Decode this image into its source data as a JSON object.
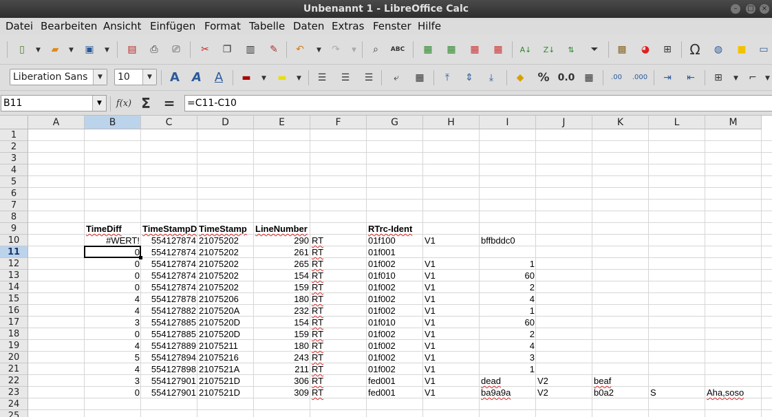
{
  "window": {
    "title": "Unbenannt 1 - LibreOffice Calc"
  },
  "menu": [
    "Datei",
    "Bearbeiten",
    "Ansicht",
    "Einfügen",
    "Format",
    "Tabelle",
    "Daten",
    "Extras",
    "Fenster",
    "Hilfe"
  ],
  "format_toolbar": {
    "font_name": "Liberation Sans",
    "font_size": "10"
  },
  "formula_bar": {
    "name_box": "B11",
    "formula": "=C11-C10"
  },
  "columns": [
    "A",
    "B",
    "C",
    "D",
    "E",
    "F",
    "G",
    "H",
    "I",
    "J",
    "K",
    "L",
    "M"
  ],
  "rows": [
    "1",
    "2",
    "3",
    "4",
    "5",
    "6",
    "7",
    "8",
    "9",
    "10",
    "11",
    "12",
    "13",
    "14",
    "15",
    "16",
    "17",
    "18",
    "19",
    "20",
    "21",
    "22",
    "23",
    "24",
    "25"
  ],
  "selection": {
    "column": "B",
    "row": "11"
  },
  "cells": {
    "header": {
      "B": "TimeDiff",
      "C": "TimeStampD",
      "D": "TimeStamp",
      "E": "LineNumber",
      "G": "RTrc-Ident"
    },
    "data": [
      {
        "row": "10",
        "B": "#WERT!",
        "C": "554127874",
        "D": "21075202",
        "E": "290",
        "F": "RT",
        "G": "01f100",
        "H": "V1",
        "I": "bffbddc0"
      },
      {
        "row": "11",
        "B": "0",
        "C": "554127874",
        "D": "21075202",
        "E": "261",
        "F": "RT",
        "G": "01f001"
      },
      {
        "row": "12",
        "B": "0",
        "C": "554127874",
        "D": "21075202",
        "E": "265",
        "F": "RT",
        "G": "01f002",
        "H": "V1",
        "I": "1"
      },
      {
        "row": "13",
        "B": "0",
        "C": "554127874",
        "D": "21075202",
        "E": "154",
        "F": "RT",
        "G": "01f010",
        "H": "V1",
        "I": "60"
      },
      {
        "row": "14",
        "B": "0",
        "C": "554127874",
        "D": "21075202",
        "E": "159",
        "F": "RT",
        "G": "01f002",
        "H": "V1",
        "I": "2"
      },
      {
        "row": "15",
        "B": "4",
        "C": "554127878",
        "D": "21075206",
        "E": "180",
        "F": "RT",
        "G": "01f002",
        "H": "V1",
        "I": "4"
      },
      {
        "row": "16",
        "B": "4",
        "C": "554127882",
        "D": "2107520A",
        "E": "232",
        "F": "RT",
        "G": "01f002",
        "H": "V1",
        "I": "1"
      },
      {
        "row": "17",
        "B": "3",
        "C": "554127885",
        "D": "2107520D",
        "E": "154",
        "F": "RT",
        "G": "01f010",
        "H": "V1",
        "I": "60"
      },
      {
        "row": "18",
        "B": "0",
        "C": "554127885",
        "D": "2107520D",
        "E": "159",
        "F": "RT",
        "G": "01f002",
        "H": "V1",
        "I": "2"
      },
      {
        "row": "19",
        "B": "4",
        "C": "554127889",
        "D": "21075211",
        "E": "180",
        "F": "RT",
        "G": "01f002",
        "H": "V1",
        "I": "4"
      },
      {
        "row": "20",
        "B": "5",
        "C": "554127894",
        "D": "21075216",
        "E": "243",
        "F": "RT",
        "G": "01f002",
        "H": "V1",
        "I": "3"
      },
      {
        "row": "21",
        "B": "4",
        "C": "554127898",
        "D": "2107521A",
        "E": "211",
        "F": "RT",
        "G": "01f002",
        "H": "V1",
        "I": "1"
      },
      {
        "row": "22",
        "B": "3",
        "C": "554127901",
        "D": "2107521D",
        "E": "306",
        "F": "RT",
        "G": "fed001",
        "H": "V1",
        "I": "dead",
        "J": "V2",
        "K": "beaf"
      },
      {
        "row": "23",
        "B": "0",
        "C": "554127901",
        "D": "2107521D",
        "E": "309",
        "F": "RT",
        "G": "fed001",
        "H": "V1",
        "I": "ba9a9a",
        "J": "V2",
        "K": "b0a2",
        "L": "S",
        "M": "Aha,soso"
      }
    ]
  },
  "icons": {
    "toolbar1": [
      "new-document-icon",
      "open-folder-icon",
      "save-icon",
      "export-pdf-icon",
      "print-icon",
      "print-preview-icon",
      "cut-icon",
      "copy-icon",
      "paste-icon",
      "clone-format-icon",
      "undo-icon",
      "redo-icon",
      "find-replace-icon",
      "spellcheck-icon",
      "row-icon",
      "column-icon",
      "delete-row-icon",
      "delete-column-icon",
      "sort-ascending-icon",
      "sort-descending-icon",
      "sort-icon",
      "autofilter-icon",
      "image-icon",
      "chart-icon",
      "pivot-table-icon",
      "special-character-icon",
      "hyperlink-icon",
      "comment-icon",
      "header-footer-icon"
    ],
    "toolbar2": [
      "font-outline-icon",
      "font-shadow-icon",
      "font-color-a-icon",
      "background-color-icon",
      "highlight-icon",
      "align-left-icon",
      "align-center-icon",
      "align-right-icon",
      "wrap-text-icon",
      "merge-cells-icon",
      "align-top-icon",
      "align-middle-icon",
      "align-bottom-icon",
      "currency-icon",
      "percent-icon",
      "number-format-icon",
      "date-format-icon",
      "add-decimal-icon",
      "delete-decimal-icon",
      "increase-indent-icon",
      "decrease-indent-icon",
      "borders-icon",
      "border-style-icon"
    ]
  },
  "colors": {
    "selection_header": "#bcd3ec",
    "spell_underline": "#d22222",
    "titlebar": "#3a3a3a"
  }
}
